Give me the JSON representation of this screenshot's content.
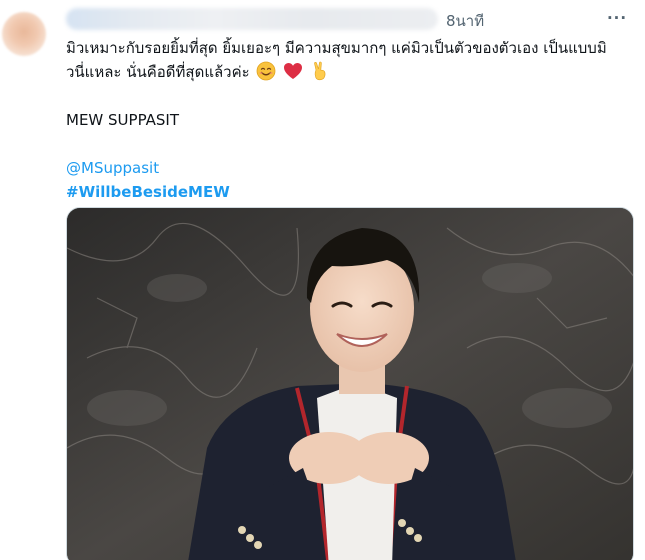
{
  "tweet": {
    "time": "8นาที",
    "more_icon": "more-horizontal-icon",
    "text_lines": [
      "มิวเหมาะกับรอยยิ้มที่สุด ยิ้มเยอะๆ มีความสุขมากๆ แค่มิวเป็นตัวของตัวเอง เป็นแบบมิ",
      "วนี่แหละ นั่นคือดีที่สุดแล้วค่ะ"
    ],
    "emojis": [
      "smiling-face-emoji",
      "red-heart-emoji",
      "victory-hand-emoji"
    ],
    "name_line": "MEW SUPPASIT",
    "mention": "@MSuppasit",
    "hashtag": "#WillbeBesideMEW",
    "photo": "photo-of-smiling-man-in-dark-blazer"
  },
  "colors": {
    "link": "#1d9bf0",
    "text": "#0f1419",
    "muted": "#536471"
  }
}
